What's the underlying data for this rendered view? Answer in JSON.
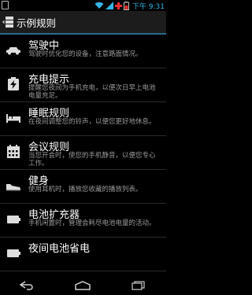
{
  "status_bar": {
    "time": "下午 9:31"
  },
  "action_bar": {
    "title": "示例规则"
  },
  "rules": [
    {
      "icon": "car-icon",
      "title": "驾驶中",
      "description": "驾驶时优化您的设备，注意路面情况。"
    },
    {
      "icon": "charging-icon",
      "title": "充电提示",
      "description": "提醒您夜间为手机充电，以便次日早上电池电量充足。"
    },
    {
      "icon": "bed-icon",
      "title": "睡眠规则",
      "description": "在夜间调整您的铃声，以便您更好地休息。"
    },
    {
      "icon": "calendar-icon",
      "title": "会议规则",
      "description": "当您开会时，使您的手机静音，以便您专心工作。"
    },
    {
      "icon": "sneaker-icon",
      "title": "健身",
      "description": "使用耳机时，播放您收藏的播放列表。"
    },
    {
      "icon": "battery-icon",
      "title": "电池扩充器",
      "description": "手机闲置时，管理会耗尽电池电量的活动。"
    },
    {
      "icon": "battery-icon",
      "title": "夜间电池省电",
      "description": ""
    }
  ]
}
